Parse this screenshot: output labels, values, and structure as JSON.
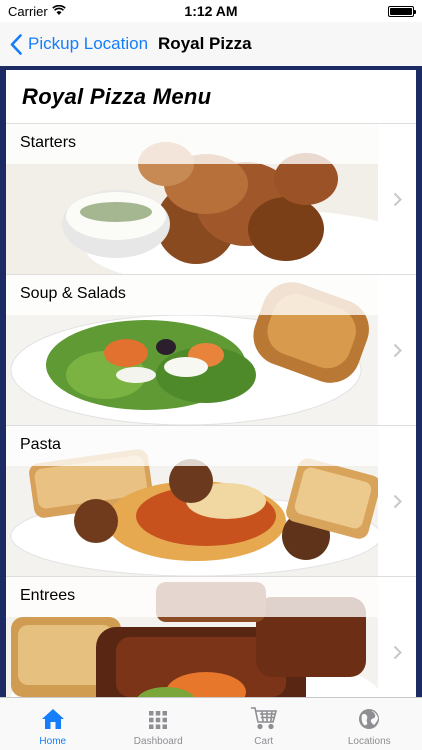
{
  "status": {
    "carrier": "Carrier",
    "time": "1:12 AM"
  },
  "nav": {
    "back_label": "Pickup Location",
    "title": "Royal Pizza"
  },
  "menu": {
    "title": "Royal Pizza Menu",
    "items": [
      {
        "label": "Starters"
      },
      {
        "label": "Soup & Salads"
      },
      {
        "label": "Pasta"
      },
      {
        "label": "Entrees"
      }
    ]
  },
  "tabs": [
    {
      "label": "Home",
      "icon": "home-icon"
    },
    {
      "label": "Dashboard",
      "icon": "grid-icon"
    },
    {
      "label": "Cart",
      "icon": "cart-icon"
    },
    {
      "label": "Locations",
      "icon": "globe-icon"
    }
  ],
  "colors": {
    "accent": "#157efb",
    "frame": "#1c2b63"
  }
}
